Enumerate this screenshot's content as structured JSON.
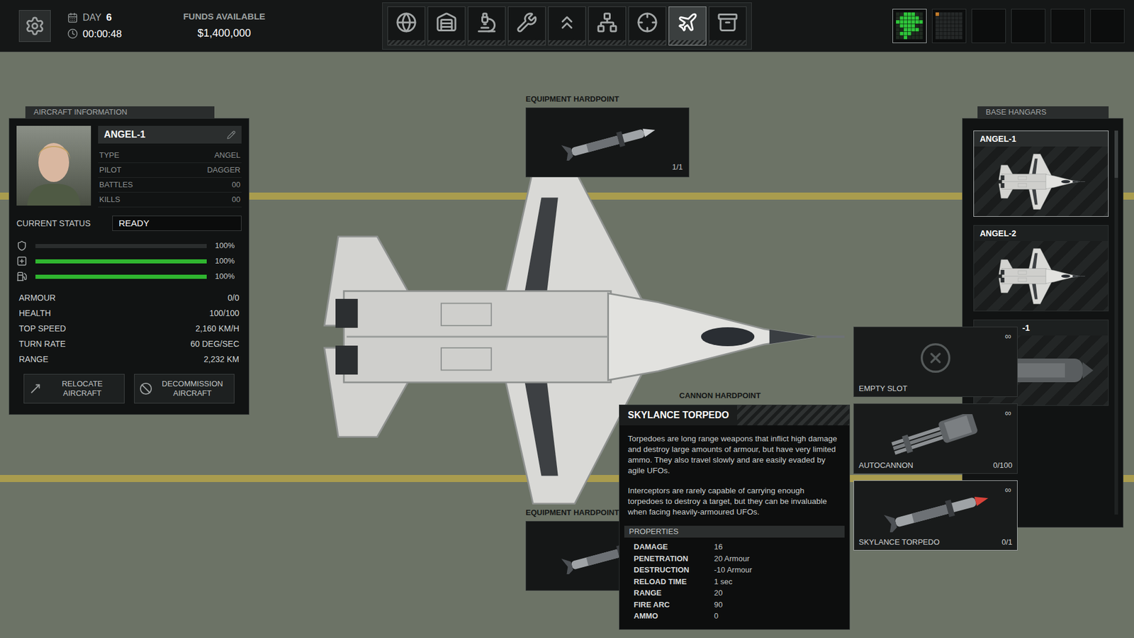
{
  "top_bar": {
    "day_label": "DAY",
    "day": "6",
    "clock": "00:00:48",
    "funds_label": "FUNDS AVAILABLE",
    "funds": "$1,400,000",
    "nav": [
      {
        "selected": false
      },
      {
        "selected": false
      },
      {
        "selected": false
      },
      {
        "selected": false
      },
      {
        "selected": false
      },
      {
        "selected": false
      },
      {
        "selected": false
      },
      {
        "selected": true
      },
      {
        "selected": false
      }
    ],
    "minimap": [
      {
        "kind": "grid-green",
        "selected": true
      },
      {
        "kind": "grid-dim",
        "selected": false
      },
      {
        "kind": "empty",
        "selected": false
      },
      {
        "kind": "empty",
        "selected": false
      },
      {
        "kind": "empty",
        "selected": false
      },
      {
        "kind": "empty",
        "selected": false
      }
    ]
  },
  "aircraft_info": {
    "title": "AIRCRAFT INFORMATION",
    "name": "ANGEL-1",
    "fields": [
      {
        "label": "TYPE",
        "value": "ANGEL"
      },
      {
        "label": "PILOT",
        "value": "DAGGER"
      },
      {
        "label": "BATTLES",
        "value": "00"
      },
      {
        "label": "KILLS",
        "value": "00"
      }
    ],
    "status_label": "CURRENT STATUS",
    "status": "READY",
    "bars": [
      {
        "level": 0,
        "reading": "100%",
        "color": "#2fb52f"
      },
      {
        "level": 1,
        "reading": "100%",
        "color": "#2fb52f"
      },
      {
        "level": 1,
        "reading": "100%",
        "color": "#2fb52f"
      }
    ],
    "stats": [
      {
        "label": "ARMOUR",
        "value": "0/0"
      },
      {
        "label": "HEALTH",
        "value": "100/100"
      },
      {
        "label": "TOP SPEED",
        "value": "2,160 KM/H"
      },
      {
        "label": "TURN RATE",
        "value": "60 DEG/SEC"
      },
      {
        "label": "RANGE",
        "value": "2,232 KM"
      }
    ],
    "buttons": [
      {
        "label": "RELOCATE AIRCRAFT"
      },
      {
        "label": "DECOMMISSION AIRCRAFT"
      }
    ]
  },
  "hardpoints": [
    {
      "label": "EQUIPMENT HARDPOINT",
      "count": "1/1"
    },
    {
      "label": "EQUIPMENT HARDPOINT",
      "count": ""
    }
  ],
  "cannon_label": "CANNON HARDPOINT",
  "weapon_menu": [
    {
      "name": "EMPTY SLOT",
      "count": "",
      "stock": "∞",
      "kind": "empty",
      "selected": false
    },
    {
      "name": "AUTOCANNON",
      "count": "0/100",
      "stock": "∞",
      "kind": "gun",
      "selected": false
    },
    {
      "name": "SKYLANCE TORPEDO",
      "count": "0/1",
      "stock": "∞",
      "kind": "torpedo",
      "selected": true
    }
  ],
  "tooltip": {
    "title": "SKYLANCE TORPEDO",
    "paragraphs": [
      "Torpedoes are long range weapons that inflict high damage and destroy large amounts of armour, but have very limited ammo. They also travel slowly and are easily evaded by agile UFOs.",
      "Interceptors are rarely capable of carrying enough torpedoes to destroy a target, but they can be invaluable when facing heavily-armoured UFOs."
    ],
    "properties_label": "PROPERTIES",
    "properties": [
      {
        "label": "DAMAGE",
        "value": "16"
      },
      {
        "label": "PENETRATION",
        "value": "20 Armour"
      },
      {
        "label": "DESTRUCTION",
        "value": "-10 Armour"
      },
      {
        "label": "RELOAD TIME",
        "value": "1 sec"
      },
      {
        "label": "RANGE",
        "value": "20"
      },
      {
        "label": "FIRE ARC",
        "value": "90"
      },
      {
        "label": "AMMO",
        "value": "0"
      }
    ]
  },
  "hangars": {
    "title": "BASE HANGARS",
    "items": [
      {
        "name": "ANGEL-1",
        "selected": true,
        "kind": "jet"
      },
      {
        "name": "ANGEL-2",
        "selected": false,
        "kind": "jet"
      },
      {
        "name": "-1",
        "selected": false,
        "kind": "dropship"
      }
    ]
  }
}
